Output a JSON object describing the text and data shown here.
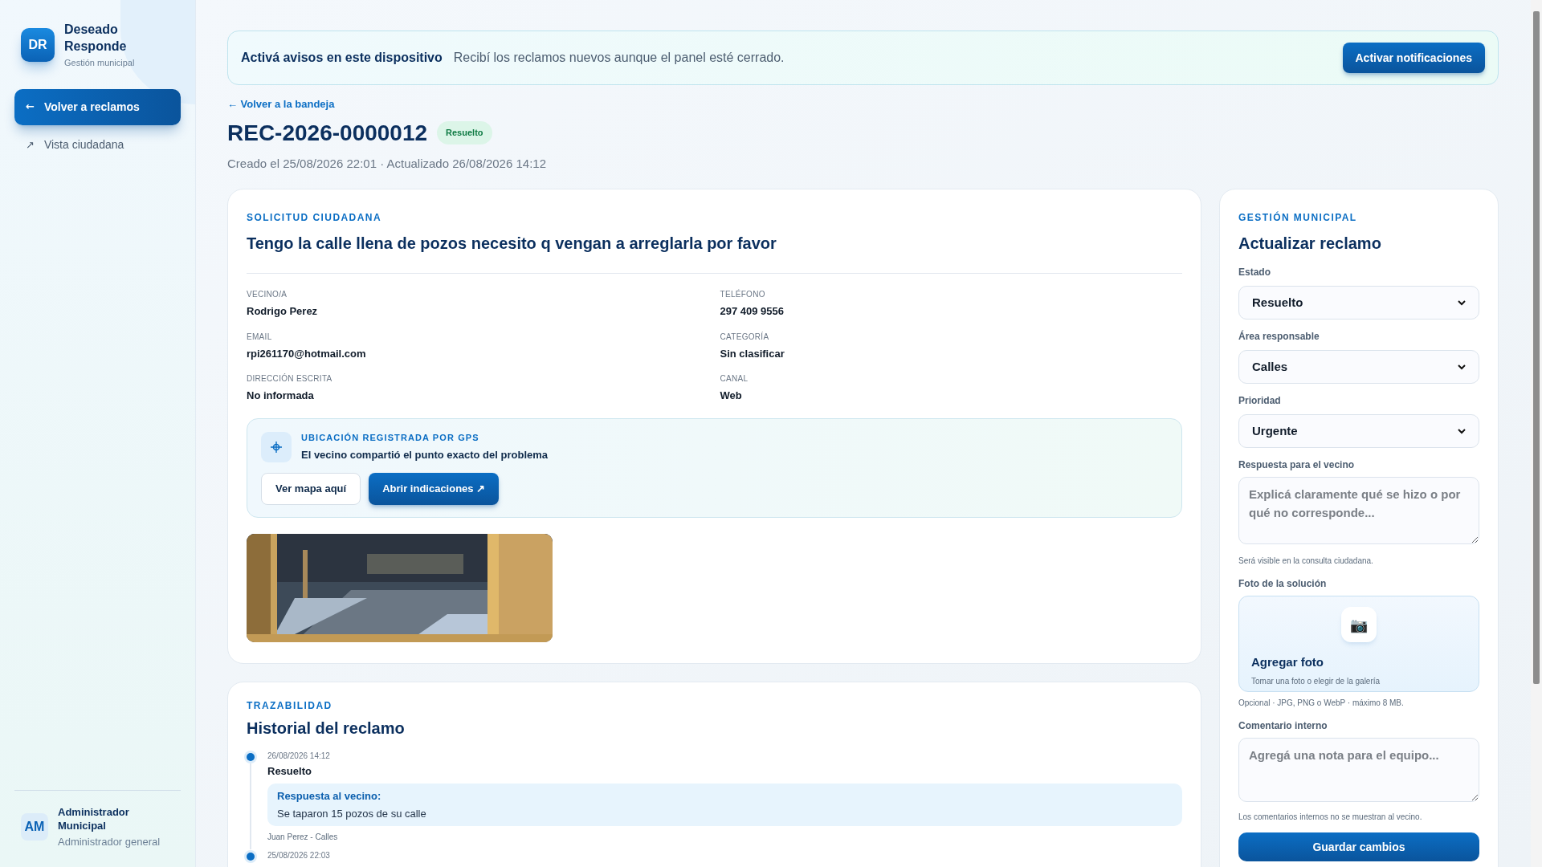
{
  "sidebar": {
    "logo": "DR",
    "brand": "Deseado Responde",
    "subtitle": "Gestión municipal",
    "nav": [
      {
        "icon": "←",
        "label": "Volver a reclamos",
        "selected": true
      },
      {
        "icon": "↗",
        "label": "Vista ciudadana",
        "selected": false
      }
    ],
    "user": {
      "initials": "AM",
      "name": "Administrador Municipal",
      "role": "Administrador general"
    }
  },
  "banner": {
    "title": "Activá avisos en este dispositivo",
    "text": "Recibí los reclamos nuevos aunque el panel esté cerrado.",
    "button": "Activar notificaciones"
  },
  "header": {
    "back_link": "← Volver a la bandeja",
    "title": "REC-2026-0000012",
    "status": "Resuelto",
    "meta": "Creado el 25/08/2026 22:01 · Actualizado 26/08/2026 14:12"
  },
  "request": {
    "eyebrow": "SOLICITUD CIUDADANA",
    "title": "Tengo la calle llena de pozos necesito q vengan a arreglarla por favor",
    "fields": [
      {
        "label": "VECINO/A",
        "value": "Rodrigo Perez"
      },
      {
        "label": "TELÉFONO",
        "value": "297 409 9556"
      },
      {
        "label": "EMAIL",
        "value": "rpi261170@hotmail.com"
      },
      {
        "label": "CATEGORÍA",
        "value": "Sin clasificar"
      },
      {
        "label": "DIRECCIÓN ESCRITA",
        "value": "No informada"
      },
      {
        "label": "CANAL",
        "value": "Web"
      }
    ],
    "gps": {
      "eyebrow": "UBICACIÓN REGISTRADA POR GPS",
      "text": "El vecino compartió el punto exacto del problema",
      "buttons": [
        {
          "label": "Ver mapa aquí",
          "kind": "secondary"
        },
        {
          "label": "Abrir indicaciones ↗",
          "kind": "primary"
        }
      ]
    }
  },
  "history": {
    "eyebrow": "TRAZABILIDAD",
    "title": "Historial del reclamo",
    "entries": [
      {
        "date": "26/08/2026 14:12",
        "status": "Resuelto",
        "reply_label": "Respuesta al vecino:",
        "reply": "Se taparon 15 pozos de su calle",
        "author": "Juan Perez - Calles"
      },
      {
        "date": "25/08/2026 22:03"
      }
    ]
  },
  "update": {
    "eyebrow": "GESTIÓN MUNICIPAL",
    "title": "Actualizar reclamo",
    "selects": [
      {
        "label": "Estado",
        "value": "Resuelto"
      },
      {
        "label": "Área responsable",
        "value": "Calles"
      },
      {
        "label": "Prioridad",
        "value": "Urgente"
      }
    ],
    "reply": {
      "label": "Respuesta para el vecino",
      "placeholder": "Explicá claramente qué se hizo o por qué no corresponde...",
      "hint": "Será visible en la consulta ciudadana."
    },
    "photo": {
      "label": "Foto de la solución",
      "icon": "📷",
      "title": "Agregar foto",
      "text": "Tomar una foto o elegir de la galería",
      "hint": "Opcional · JPG, PNG o WebP · máximo 8 MB."
    },
    "comment": {
      "label": "Comentario interno",
      "placeholder": "Agregá una nota para el equipo...",
      "hint": "Los comentarios internos no se muestran al vecino."
    },
    "save": "Guardar cambios"
  }
}
